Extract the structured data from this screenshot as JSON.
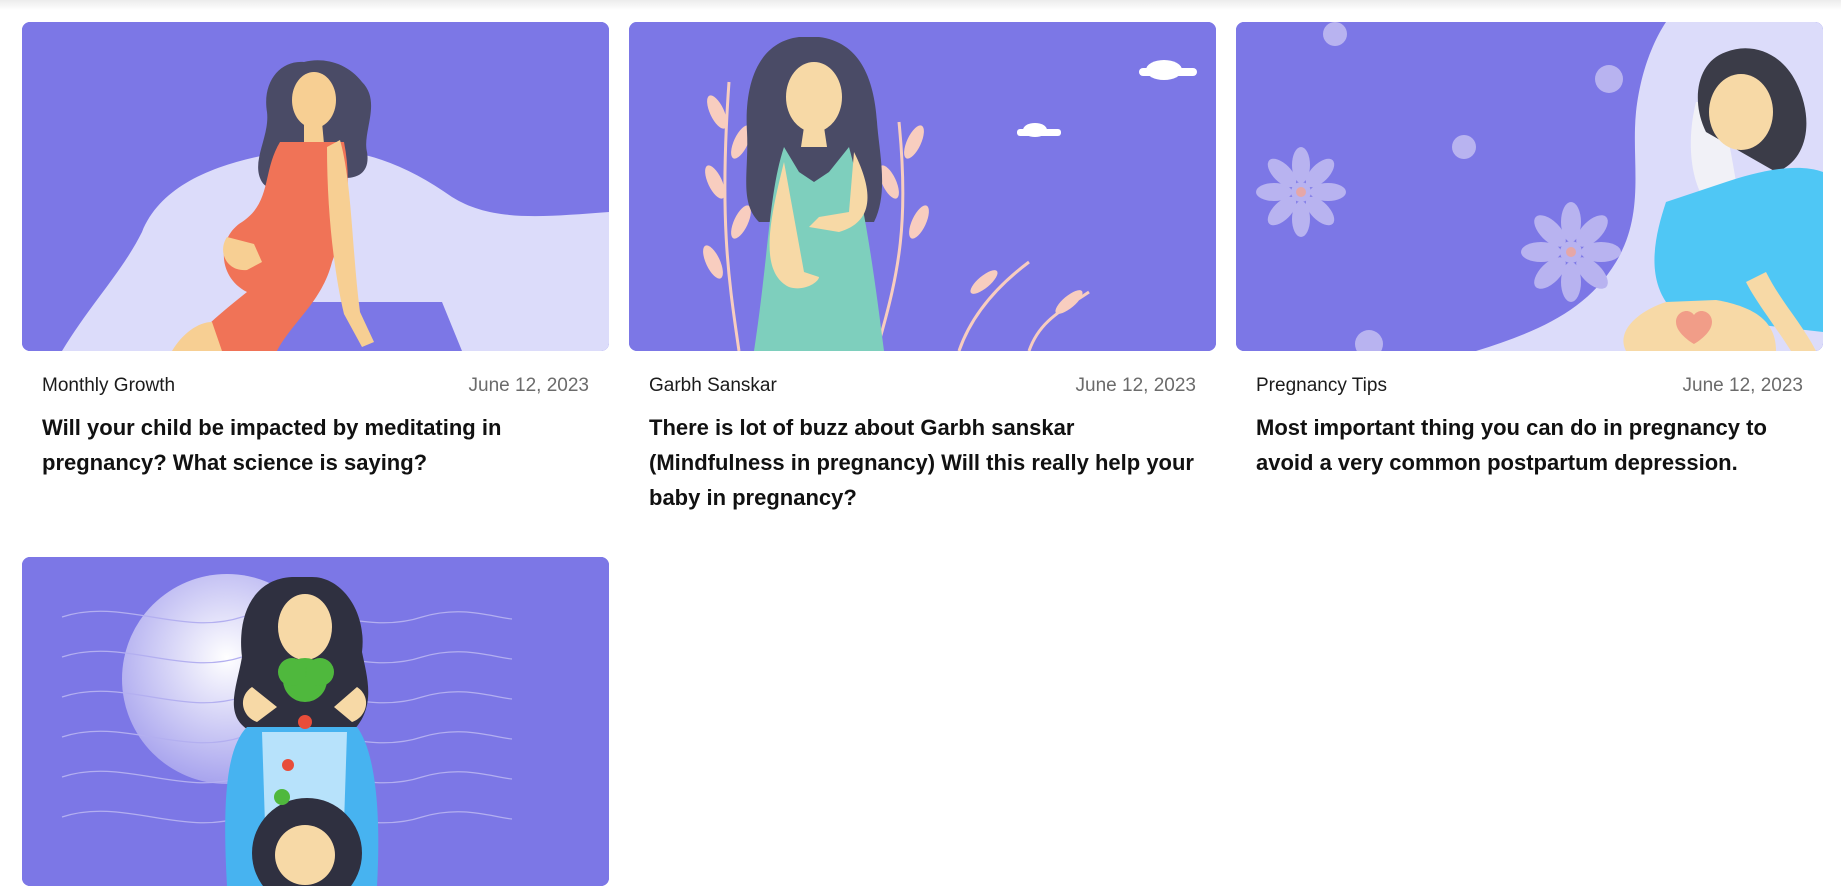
{
  "posts": [
    {
      "category": "Monthly Growth",
      "date": "June 12, 2023",
      "title": "Will your child be impacted by meditating in pregnancy? What science is saying?",
      "image": "illustration-pregnant-woman-red-dress"
    },
    {
      "category": "Garbh Sanskar",
      "date": "June 12, 2023",
      "title": "There is lot of buzz about Garbh sanskar (Mindfulness in pregnancy) Will this really help your baby in pregnancy?",
      "image": "illustration-pregnant-woman-green-dress-leaves"
    },
    {
      "category": "Pregnancy Tips",
      "date": "June 12, 2023",
      "title": "Most important thing you can do in pregnancy to avoid a very common postpartum depression.",
      "image": "illustration-pregnant-woman-resting-flowers"
    },
    {
      "category": "",
      "date": "",
      "title": "",
      "image": "illustration-woman-with-fruit-and-baby"
    }
  ],
  "colors": {
    "card_bg": "#7c77e6",
    "title_text": "#111111",
    "date_text": "#6b6b6b"
  }
}
